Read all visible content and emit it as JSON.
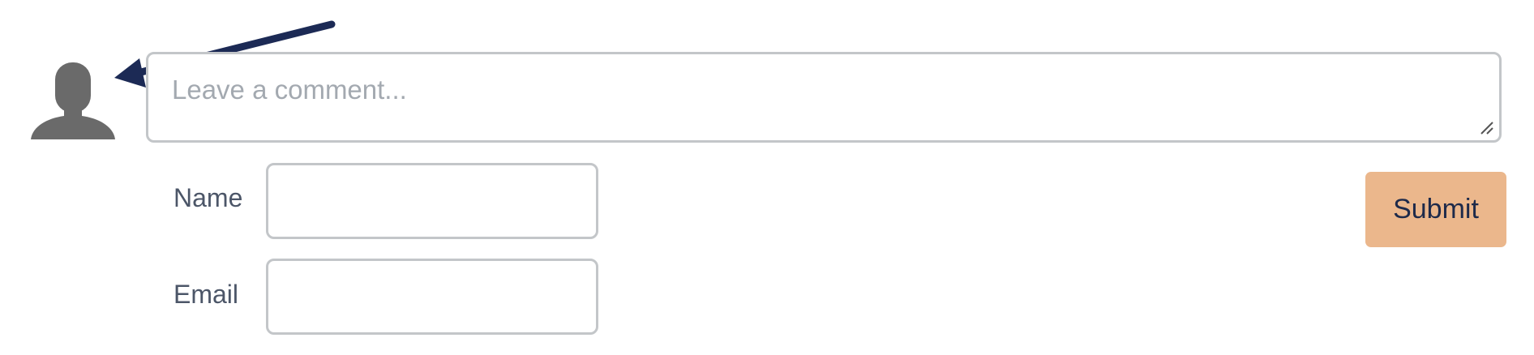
{
  "comment": {
    "placeholder": "Leave a comment..."
  },
  "fields": {
    "name_label": "Name",
    "name_value": "",
    "email_label": "Email",
    "email_value": ""
  },
  "submit_label": "Submit",
  "colors": {
    "submit_bg": "#ebb78c",
    "submit_text": "#1e2a4a",
    "border": "#c3c6c9",
    "placeholder": "#a3a9b0",
    "avatar": "#6a6a6a",
    "arrow": "#1c2a55"
  },
  "icons": {
    "avatar": "user-silhouette-icon",
    "annotation": "arrow-annotation",
    "resize": "resize-grip-icon"
  }
}
